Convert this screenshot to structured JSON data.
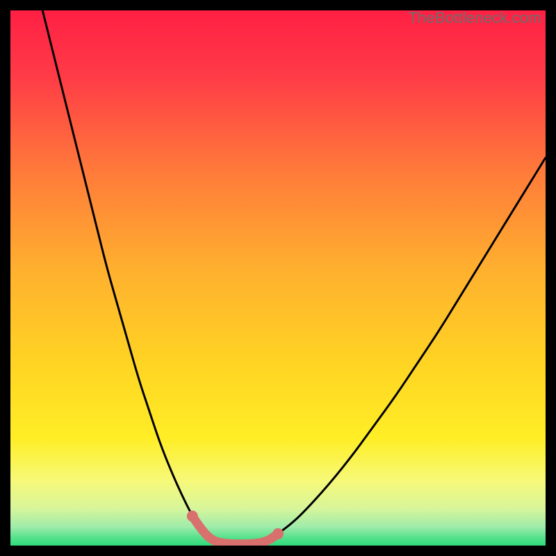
{
  "attribution": "TheBottleneck.com",
  "colors": {
    "background": "#000000",
    "curve": "#000000",
    "highlight": "#d8706e",
    "gradient_top": "#ff2044",
    "gradient_mid": "#ffd400",
    "gradient_green": "#35e27c"
  },
  "chart_data": {
    "type": "line",
    "title": "",
    "xlabel": "",
    "ylabel": "",
    "xlim": [
      0,
      100
    ],
    "ylim": [
      0,
      100
    ],
    "annotations": [],
    "series": [
      {
        "name": "left-curve",
        "x": [
          6,
          8,
          10,
          12,
          14,
          16,
          18,
          20,
          22,
          24,
          26,
          28,
          30,
          32,
          34,
          36,
          38
        ],
        "values": [
          100,
          92,
          84,
          76,
          68,
          60,
          52,
          45,
          38,
          31,
          25,
          19,
          14,
          9.5,
          5.5,
          2.5,
          0.8
        ]
      },
      {
        "name": "valley-floor",
        "x": [
          38,
          40,
          42,
          44,
          46,
          48
        ],
        "values": [
          0.8,
          0.4,
          0.3,
          0.3,
          0.4,
          0.8
        ]
      },
      {
        "name": "right-curve",
        "x": [
          48,
          50,
          53,
          56,
          60,
          64,
          68,
          72,
          76,
          80,
          84,
          88,
          92,
          96,
          100
        ],
        "values": [
          0.8,
          2.2,
          4.5,
          7.5,
          12,
          17,
          22.5,
          28,
          34,
          40,
          46.5,
          53,
          59.5,
          66,
          72.5
        ]
      }
    ],
    "highlight_range_x": [
      34,
      52
    ],
    "background_gradient": "vertical red→orange→yellow→green"
  }
}
